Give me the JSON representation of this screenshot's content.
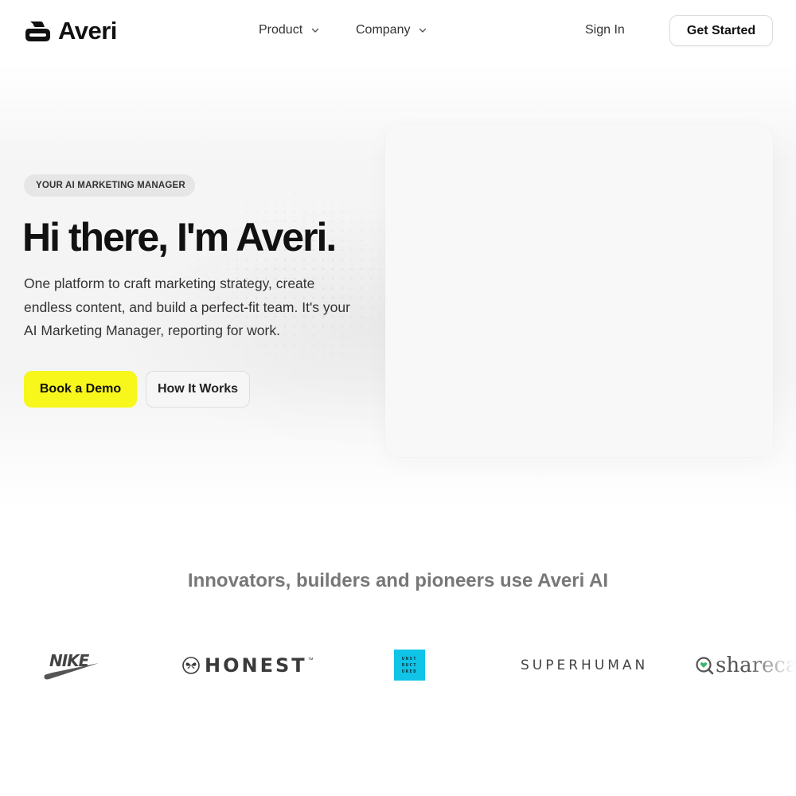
{
  "brand": {
    "name": "Averi",
    "logo_icon": "averi-mark-icon"
  },
  "nav": {
    "product_label": "Product",
    "company_label": "Company",
    "sign_in_label": "Sign In",
    "get_started_label": "Get Started"
  },
  "hero": {
    "badge_icon": "",
    "badge_label": "YOUR AI MARKETING MANAGER",
    "title": "Hi there, I'm Averi.",
    "subtitle": "One platform to craft marketing strategy, create endless content, and build a perfect-fit team. It's your AI Marketing Manager, reporting for work.",
    "primary_cta": "Book a Demo",
    "secondary_cta": "How It Works"
  },
  "customers": {
    "heading": "Innovators, builders and pioneers use Averi AI",
    "logos": {
      "nike": "NIKE",
      "honest": "HONEST",
      "honest_tm": "™",
      "unstructured_lines": [
        "UNST",
        "RUCT",
        "URED"
      ],
      "superhuman": "SUPERHUMAN",
      "sharecare": "sharecare"
    }
  },
  "colors": {
    "primary_cta_bg": "#f7f71c",
    "unstructured_bg": "#10c4e8",
    "text_dark": "#111111",
    "text_muted": "#777777"
  }
}
